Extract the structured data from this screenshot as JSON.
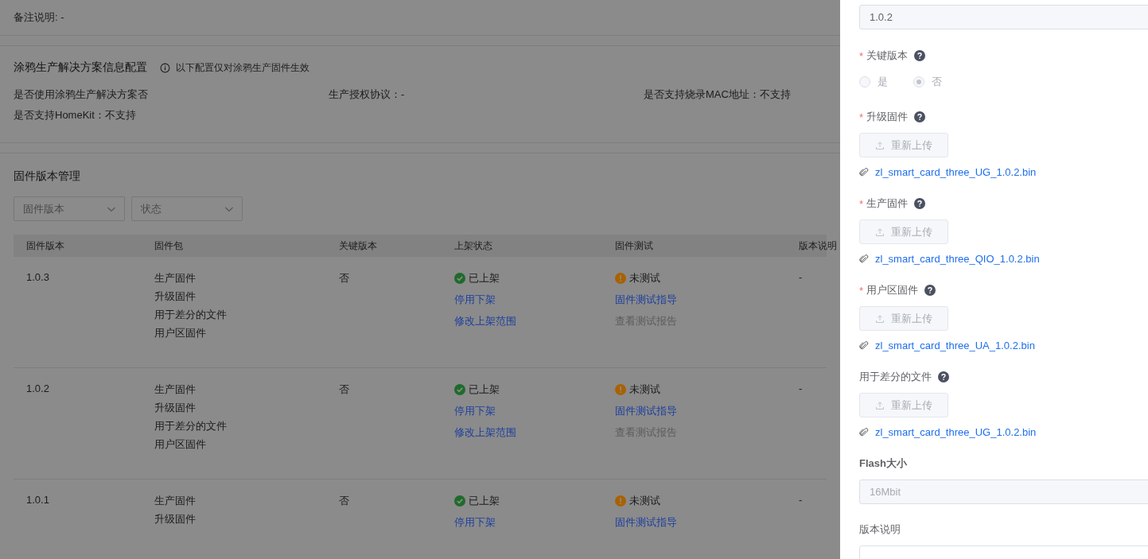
{
  "remark": "备注说明: -",
  "solution": {
    "title": "涂鸦生产解决方案信息配置",
    "note": "以下配置仅对涂鸦生产固件生效",
    "fields": [
      "是否使用涂鸦生产解决方案否",
      "生产授权协议：-",
      "是否支持烧录MAC地址：不支持",
      "是否支持HomeKit：不支持"
    ]
  },
  "firmware": {
    "title": "固件版本管理",
    "filters": [
      {
        "placeholder": "固件版本"
      },
      {
        "placeholder": "状态"
      }
    ],
    "table": {
      "columns": [
        "固件版本",
        "固件包",
        "关键版本",
        "上架状态",
        "固件测试",
        "版本说明"
      ],
      "rows": [
        {
          "version": "1.0.3",
          "packages": [
            "生产固件",
            "升级固件",
            "用于差分的文件",
            "用户区固件"
          ],
          "key": "否",
          "listing": {
            "kind": "ok",
            "status": "已上架",
            "actions": [
              {
                "label": "停用下架",
                "disabled": false
              },
              {
                "label": "修改上架范围",
                "disabled": false
              }
            ]
          },
          "test": {
            "kind": "warning",
            "status": "未测试",
            "actions": [
              {
                "label": "固件测试指导",
                "disabled": false
              },
              {
                "label": "查看测试报告",
                "disabled": true
              }
            ]
          },
          "note": "-"
        },
        {
          "version": "1.0.2",
          "packages": [
            "生产固件",
            "升级固件",
            "用于差分的文件",
            "用户区固件"
          ],
          "key": "否",
          "listing": {
            "kind": "ok",
            "status": "已上架",
            "actions": [
              {
                "label": "停用下架",
                "disabled": false
              },
              {
                "label": "修改上架范围",
                "disabled": false
              }
            ]
          },
          "test": {
            "kind": "warning",
            "status": "未测试",
            "actions": [
              {
                "label": "固件测试指导",
                "disabled": false
              },
              {
                "label": "查看测试报告",
                "disabled": true
              }
            ]
          },
          "note": "-"
        },
        {
          "version": "1.0.1",
          "packages": [
            "生产固件",
            "升级固件"
          ],
          "key": "否",
          "listing": {
            "kind": "ok",
            "status": "已上架",
            "actions": [
              {
                "label": "停用下架",
                "disabled": false
              }
            ]
          },
          "test": {
            "kind": "warning",
            "status": "未测试",
            "actions": [
              {
                "label": "固件测试指导",
                "disabled": false
              }
            ]
          },
          "note": "-"
        }
      ]
    }
  },
  "drawer": {
    "version_value": "1.0.2",
    "fields": [
      {
        "kind": "radio",
        "label": "关键版本",
        "required_mark": "*",
        "help": true,
        "options": [
          {
            "label": "是",
            "selected": false
          },
          {
            "label": "否",
            "selected": true
          }
        ]
      },
      {
        "kind": "upload",
        "label": "升级固件",
        "required_mark": "*",
        "help": true,
        "button": "重新上传",
        "file": "zl_smart_card_three_UG_1.0.2.bin"
      },
      {
        "kind": "upload",
        "label": "生产固件",
        "required_mark": "*",
        "help": true,
        "button": "重新上传",
        "file": "zl_smart_card_three_QIO_1.0.2.bin"
      },
      {
        "kind": "upload",
        "label": "用户区固件",
        "required_mark": "*",
        "help": true,
        "button": "重新上传",
        "file": "zl_smart_card_three_UA_1.0.2.bin"
      },
      {
        "kind": "upload",
        "label": "用于差分的文件",
        "help": true,
        "button": "重新上传",
        "file": "zl_smart_card_three_UG_1.0.2.bin"
      },
      {
        "kind": "input",
        "label": "Flash大小",
        "help": false,
        "value": "16Mbit"
      },
      {
        "kind": "textarea",
        "label": "版本说明",
        "help": false
      }
    ]
  }
}
